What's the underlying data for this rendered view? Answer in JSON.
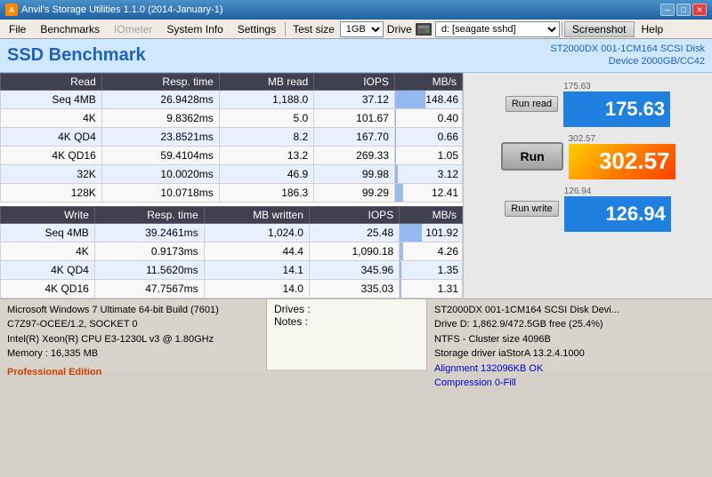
{
  "titleBar": {
    "title": "Anvil's Storage Utilities 1.1.0 (2014-January-1)",
    "icon": "A",
    "buttons": {
      "min": "─",
      "max": "□",
      "close": "✕"
    }
  },
  "menuBar": {
    "items": [
      "File",
      "Benchmarks",
      "IOmeter",
      "System Info",
      "Settings"
    ],
    "testSizeLabel": "Test size",
    "testSizeValue": "1GB",
    "driveLabel": "Drive",
    "driveValue": "d: [seagate sshd]",
    "screenshotLabel": "Screenshot",
    "helpLabel": "Help"
  },
  "ssdBenchmark": {
    "title": "SSD Benchmark",
    "diskInfo": "ST2000DX 001-1CM164 SCSI Disk\nDevice 2000GB/CC42"
  },
  "readTable": {
    "headers": [
      "Read",
      "Resp. time",
      "MB read",
      "IOPS",
      "MB/s"
    ],
    "rows": [
      {
        "label": "Seq 4MB",
        "respTime": "26.9428ms",
        "mbRead": "1,188.0",
        "iops": "37.12",
        "mbs": "148.46",
        "barPct": 45
      },
      {
        "label": "4K",
        "respTime": "9.8362ms",
        "mbRead": "5.0",
        "iops": "101.67",
        "mbs": "0.40",
        "barPct": 1
      },
      {
        "label": "4K QD4",
        "respTime": "23.8521ms",
        "mbRead": "8.2",
        "iops": "167.70",
        "mbs": "0.66",
        "barPct": 1
      },
      {
        "label": "4K QD16",
        "respTime": "59.4104ms",
        "mbRead": "13.2",
        "iops": "269.33",
        "mbs": "1.05",
        "barPct": 2
      },
      {
        "label": "32K",
        "respTime": "10.0020ms",
        "mbRead": "46.9",
        "iops": "99.98",
        "mbs": "3.12",
        "barPct": 4
      },
      {
        "label": "128K",
        "respTime": "10.0718ms",
        "mbRead": "186.3",
        "iops": "99.29",
        "mbs": "12.41",
        "barPct": 12
      }
    ]
  },
  "writeTable": {
    "headers": [
      "Write",
      "Resp. time",
      "MB written",
      "IOPS",
      "MB/s"
    ],
    "rows": [
      {
        "label": "Seq 4MB",
        "respTime": "39.2461ms",
        "mbWritten": "1,024.0",
        "iops": "25.48",
        "mbs": "101.92",
        "barPct": 35
      },
      {
        "label": "4K",
        "respTime": "0.9173ms",
        "mbWritten": "44.4",
        "iops": "1,090.18",
        "mbs": "4.26",
        "barPct": 5
      },
      {
        "label": "4K QD4",
        "respTime": "11.5620ms",
        "mbWritten": "14.1",
        "iops": "345.96",
        "mbs": "1.35",
        "barPct": 2
      },
      {
        "label": "4K QD16",
        "respTime": "47.7567ms",
        "mbWritten": "14.0",
        "iops": "335.03",
        "mbs": "1.31",
        "barPct": 2
      }
    ]
  },
  "rightPanel": {
    "readScore": "175.63",
    "readScoreLabel": "175.63",
    "runReadLabel": "Run read",
    "runWriteLabel": "Run write",
    "runLabel": "Run",
    "totalScore": "302.57",
    "writeScore": "126.94",
    "writeScoreLabel": "126.94"
  },
  "statusBar": {
    "left": {
      "os": "Microsoft Windows 7 Ultimate  64-bit Build (7601)",
      "cpu1": "C7Z97-OCEE/1.2, SOCKET 0",
      "cpu2": "Intel(R) Xeon(R) CPU E3-1230L v3 @ 1.80GHz",
      "memory": "Memory : 16,335 MB",
      "edition": "Professional Edition"
    },
    "middle": {
      "drives": "Drives :",
      "notes": "Notes :"
    },
    "right": {
      "diskModel": "ST2000DX 001-1CM164 SCSI Disk Devi...",
      "driveLine": "Drive D: 1,862.9/472.5GB free (25.4%)",
      "ntfs": "NTFS - Cluster size 4096B",
      "storageDriver": "Storage driver  iaStorA 13.2.4.1000",
      "alignment": "Alignment 132096KB OK",
      "compression": "Compression 0-Fill"
    }
  }
}
